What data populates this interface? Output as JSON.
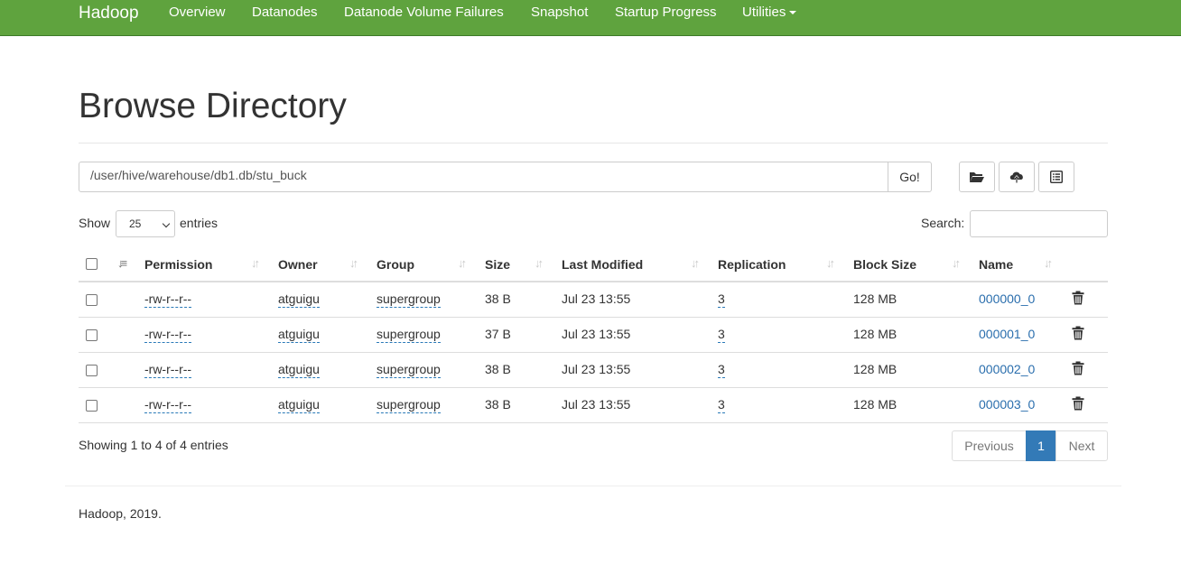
{
  "navbar": {
    "brand": "Hadoop",
    "items": [
      "Overview",
      "Datanodes",
      "Datanode Volume Failures",
      "Snapshot",
      "Startup Progress",
      "Utilities"
    ],
    "bg_color": "#5fa33e"
  },
  "page": {
    "title": "Browse Directory"
  },
  "path": {
    "value": "/user/hive/warehouse/db1.db/stu_buck",
    "go_label": "Go!"
  },
  "toolbar": {
    "icons": [
      "folder-open-icon",
      "cloud-upload-icon",
      "list-alt-icon"
    ]
  },
  "table_controls": {
    "show_label": "Show",
    "entries_value": "25",
    "entries_label": "entries",
    "search_label": "Search:"
  },
  "table": {
    "columns": [
      "Permission",
      "Owner",
      "Group",
      "Size",
      "Last Modified",
      "Replication",
      "Block Size",
      "Name"
    ],
    "rows": [
      {
        "permission": "-rw-r--r--",
        "owner": "atguigu",
        "group": "supergroup",
        "size": "38 B",
        "modified": "Jul 23 13:55",
        "replication": "3",
        "block_size": "128 MB",
        "name": "000000_0"
      },
      {
        "permission": "-rw-r--r--",
        "owner": "atguigu",
        "group": "supergroup",
        "size": "37 B",
        "modified": "Jul 23 13:55",
        "replication": "3",
        "block_size": "128 MB",
        "name": "000001_0"
      },
      {
        "permission": "-rw-r--r--",
        "owner": "atguigu",
        "group": "supergroup",
        "size": "38 B",
        "modified": "Jul 23 13:55",
        "replication": "3",
        "block_size": "128 MB",
        "name": "000002_0"
      },
      {
        "permission": "-rw-r--r--",
        "owner": "atguigu",
        "group": "supergroup",
        "size": "38 B",
        "modified": "Jul 23 13:55",
        "replication": "3",
        "block_size": "128 MB",
        "name": "000003_0"
      }
    ]
  },
  "summary": {
    "showing": "Showing 1 to 4 of 4 entries"
  },
  "pagination": {
    "previous": "Previous",
    "current": "1",
    "next": "Next",
    "active_color": "#337ab7"
  },
  "footer": {
    "text": "Hadoop, 2019."
  }
}
